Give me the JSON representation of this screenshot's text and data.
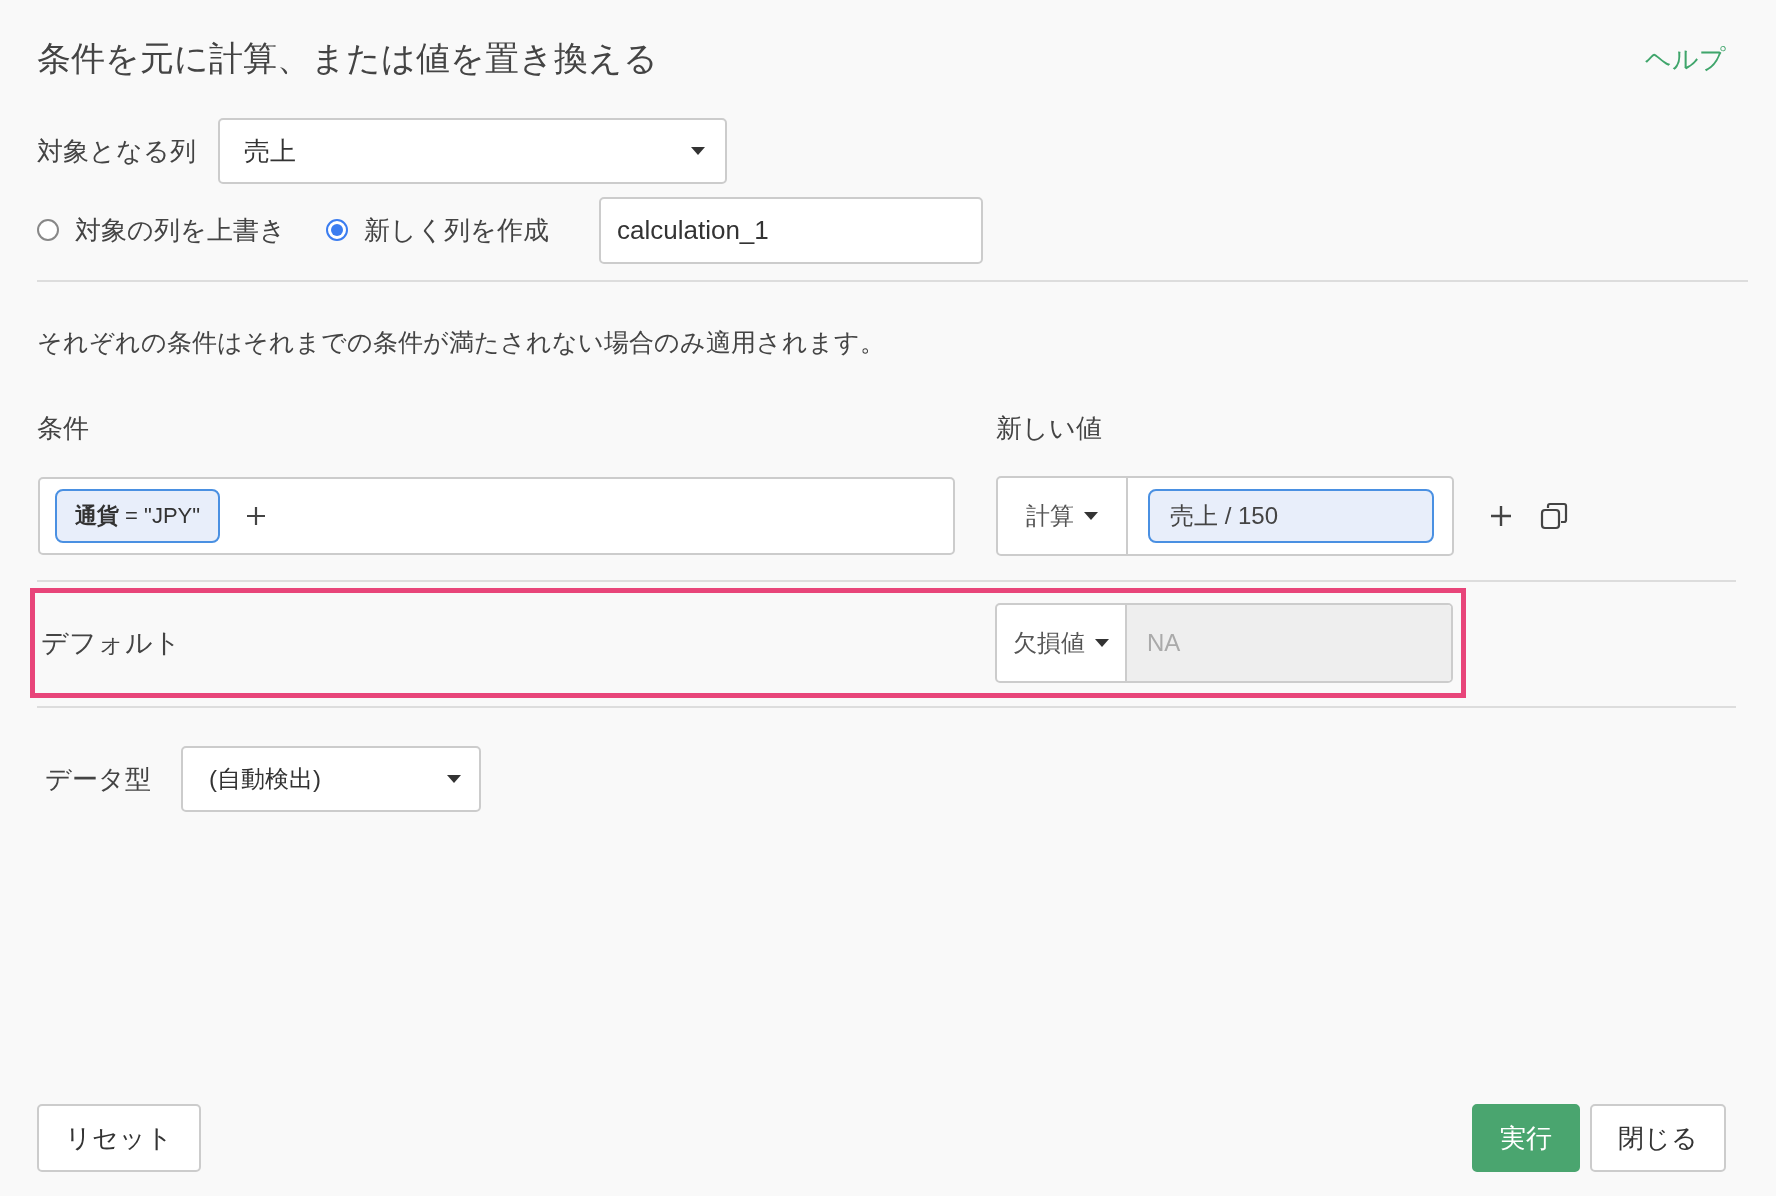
{
  "title": "条件を元に計算、または値を置き換える",
  "help_link": "ヘルプ",
  "target_column": {
    "label": "対象となる列",
    "value": "売上"
  },
  "mode_options": [
    {
      "label": "対象の列を上書き",
      "selected": false
    },
    {
      "label": "新しく列を作成",
      "selected": true
    }
  ],
  "new_column_name": {
    "value": "calculation_1"
  },
  "note": "それぞれの条件はそれまでの条件が満たされない場合のみ適用されます。",
  "conditions_header": {
    "condition_label": "条件",
    "new_value_label": "新しい値"
  },
  "conditions": [
    {
      "filters": [
        {
          "text": "**通貨** = \"JPY\""
        }
      ],
      "value_type": "計算",
      "value": "売上 / 150"
    }
  ],
  "default": {
    "label": "デフォルト",
    "highlighted": true,
    "value_type": "欠損値",
    "value": "NA",
    "disabled": true
  },
  "data_type": {
    "label": "データ型",
    "value": "(自動検出)"
  },
  "left_buttons": [
    {
      "label": "リセット",
      "kind": "secondary"
    }
  ],
  "right_buttons": [
    {
      "label": "実行",
      "kind": "primary"
    },
    {
      "label": "閉じる",
      "kind": "secondary"
    }
  ]
}
